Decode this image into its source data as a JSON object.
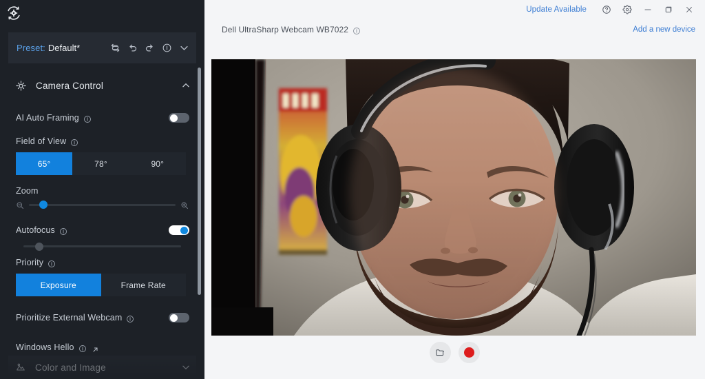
{
  "app": {
    "logo_icon": "gear-refresh-logo-icon"
  },
  "sidebar": {
    "preset": {
      "label": "Preset:",
      "value": "Default*",
      "icons": [
        {
          "name": "reset-icon",
          "title": "Reset"
        },
        {
          "name": "undo-icon",
          "title": "Undo"
        },
        {
          "name": "redo-icon",
          "title": "Redo"
        },
        {
          "name": "info-icon",
          "title": "Info"
        },
        {
          "name": "chevron-down-icon",
          "title": "Expand"
        }
      ]
    },
    "sections": [
      {
        "id": "camera-control",
        "title": "Camera Control",
        "icon": "focus-target-icon",
        "expanded": true,
        "chevron": "chevron-up-icon"
      },
      {
        "id": "color-and-image",
        "title": "Color and Image",
        "icon": "color-image-icon",
        "expanded": false,
        "chevron": "chevron-down-icon"
      }
    ],
    "controls": {
      "ai_auto_framing": {
        "label": "AI Auto Framing",
        "info_icon": "info-icon",
        "toggle_state": "off"
      },
      "field_of_view": {
        "label": "Field of View",
        "info_icon": "info-icon",
        "options": [
          "65°",
          "78°",
          "90°"
        ],
        "selected": "65°"
      },
      "zoom": {
        "label": "Zoom",
        "min_icon": "zoom-out-icon",
        "max_icon": "zoom-in-icon",
        "value_percent": 10
      },
      "autofocus": {
        "label": "Autofocus",
        "info_icon": "info-icon",
        "toggle_state": "on",
        "focus_slider_value_percent": 10,
        "focus_slider_disabled": true
      },
      "priority": {
        "label": "Priority",
        "info_icon": "info-icon",
        "options": [
          "Exposure",
          "Frame Rate"
        ],
        "selected": "Exposure"
      },
      "prioritize_external_webcam": {
        "label": "Prioritize External Webcam",
        "info_icon": "info-icon",
        "toggle_state": "off"
      },
      "windows_hello": {
        "label": "Windows Hello",
        "info_icon": "info-icon",
        "external_icon": "external-link-icon"
      }
    },
    "scrollbar": {
      "name": "sidebar-scrollbar"
    }
  },
  "titlebar": {
    "update_label": "Update Available",
    "buttons": [
      {
        "name": "help-icon",
        "label": "Help"
      },
      {
        "name": "gear-icon",
        "label": "Settings"
      },
      {
        "name": "minimize-icon",
        "label": "Minimize"
      },
      {
        "name": "maximize-icon",
        "label": "Maximize"
      },
      {
        "name": "close-icon",
        "label": "Close"
      }
    ]
  },
  "device": {
    "name": "Dell UltraSharp Webcam WB7022",
    "info_icon": "info-icon",
    "add_device_label": "Add a new device"
  },
  "preview": {
    "folder_button": {
      "name": "folder-icon",
      "label": "Open folder"
    },
    "record_button": {
      "name": "record-icon",
      "label": "Record"
    }
  },
  "colors": {
    "accent_blue": "#1281dd",
    "link_blue": "#3f7fd4",
    "sidebar_bg": "#1d2127",
    "panel_bg": "#262b33",
    "main_bg": "#f4f5f7",
    "record_red": "#dd1c1c"
  }
}
